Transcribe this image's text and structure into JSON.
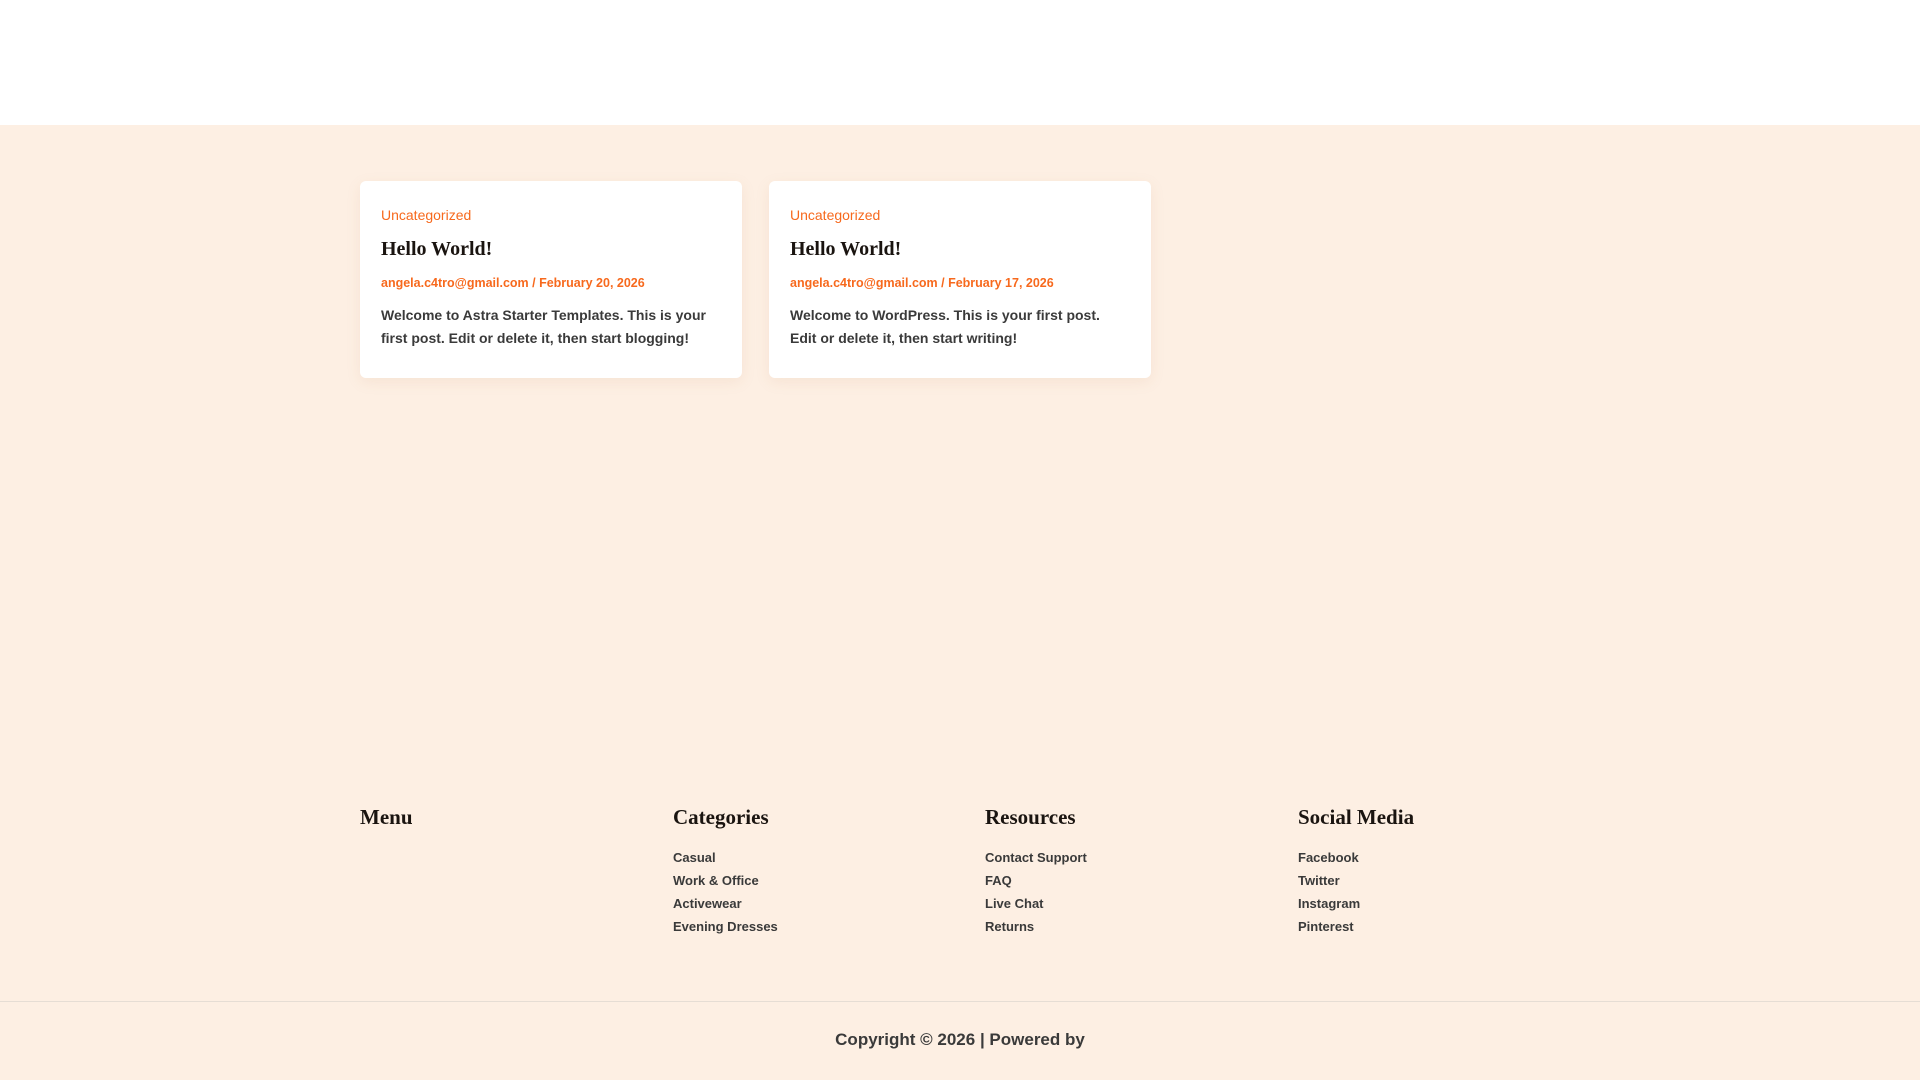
{
  "posts": [
    {
      "category": "Uncategorized",
      "title": "Hello World!",
      "author": "angela.c4tro@gmail.com",
      "date": "February 20, 2026",
      "excerpt": "Welcome to Astra Starter Templates. This is your first post. Edit or delete it, then start blogging!"
    },
    {
      "category": "Uncategorized",
      "title": "Hello World!",
      "author": "angela.c4tro@gmail.com",
      "date": "February 17, 2026",
      "excerpt": "Welcome to WordPress. This is your first post. Edit or delete it, then start writing!"
    }
  ],
  "footer": {
    "columns": [
      {
        "heading": "Menu",
        "links": []
      },
      {
        "heading": "Categories",
        "links": [
          "Casual",
          "Work & Office",
          "Activewear",
          "Evening Dresses"
        ]
      },
      {
        "heading": "Resources",
        "links": [
          "Contact Support",
          "FAQ",
          "Live Chat",
          "Returns"
        ]
      },
      {
        "heading": "Social Media",
        "links": [
          "Facebook",
          "Twitter",
          "Instagram",
          "Pinterest"
        ]
      }
    ],
    "copyright": "Copyright © 2026 | Powered by"
  },
  "colors": {
    "accent": "#f7691d",
    "background": "#fdefe3"
  }
}
